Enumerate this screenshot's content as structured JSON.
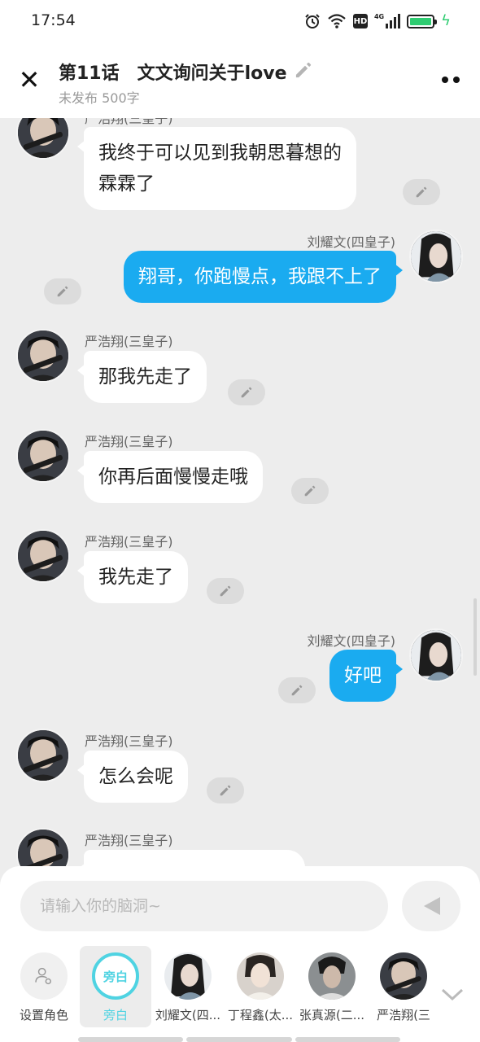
{
  "status_bar": {
    "time": "17:54",
    "icons": [
      "alarm-icon",
      "wifi-icon",
      "hd-icon",
      "signal-4g-icon",
      "battery-icon",
      "charging-icon"
    ],
    "network_label": "4G",
    "hd_label": "HD",
    "battery_level": 1.0
  },
  "header": {
    "title": "第11话　文文询问关于love",
    "subtitle": "未发布 500字",
    "close_icon": "close-icon",
    "edit_icon": "pencil-icon",
    "more_icon": "more-icon"
  },
  "messages": [
    {
      "side": "left",
      "name": "严浩翔(三皇子)",
      "text": "我终于可以见到我朝思暮想的\n霖霖了"
    },
    {
      "side": "right",
      "name": "刘耀文(四皇子)",
      "text": "翔哥，你跑慢点，我跟不上了"
    },
    {
      "side": "left",
      "name": "严浩翔(三皇子)",
      "text": "那我先走了"
    },
    {
      "side": "left",
      "name": "严浩翔(三皇子)",
      "text": "你再后面慢慢走哦"
    },
    {
      "side": "left",
      "name": "严浩翔(三皇子)",
      "text": "我先走了"
    },
    {
      "side": "right",
      "name": "刘耀文(四皇子)",
      "text": "好吧"
    },
    {
      "side": "left",
      "name": "严浩翔(三皇子)",
      "text": "怎么会呢"
    },
    {
      "side": "left",
      "name": "严浩翔(三皇子)",
      "text": ""
    }
  ],
  "composer": {
    "placeholder": "请输入你的脑洞~",
    "send_icon": "send-icon"
  },
  "roles": [
    {
      "label": "设置角色",
      "icon": "role-settings-icon"
    },
    {
      "label": "旁白",
      "badge": "旁白",
      "selected": true
    },
    {
      "label": "刘耀文(四..."
    },
    {
      "label": "丁程鑫(太..."
    },
    {
      "label": "张真源(二..."
    },
    {
      "label": "严浩翔(三"
    }
  ],
  "colors": {
    "accent_blue": "#1aabf0",
    "narration_teal": "#4fd3e2",
    "background": "#ededed"
  }
}
